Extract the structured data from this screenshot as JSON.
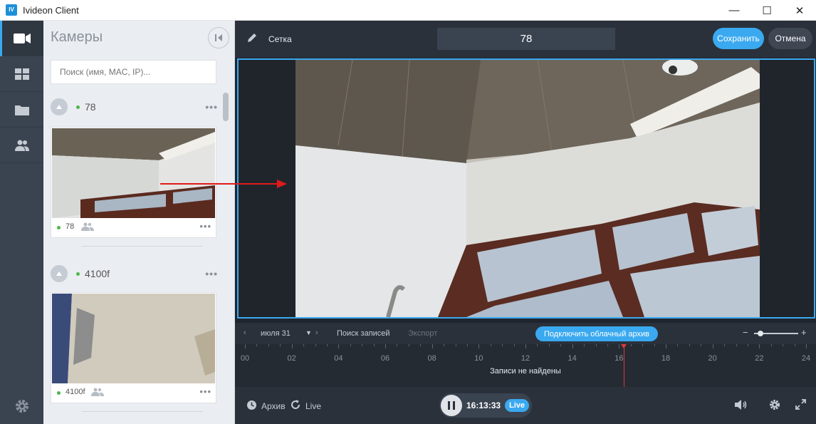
{
  "window": {
    "title": "Ivideon Client",
    "logo_text": "IV",
    "minimize": "—",
    "maximize": "☐",
    "close": "✕"
  },
  "nav": {
    "items": [
      {
        "icon": "camera-icon",
        "active": true
      },
      {
        "icon": "grid-icon",
        "active": false
      },
      {
        "icon": "folder-icon",
        "active": false
      },
      {
        "icon": "users-icon",
        "active": false
      }
    ],
    "settings_icon": "gear-icon"
  },
  "cameras_panel": {
    "title": "Камеры",
    "search_placeholder": "Поиск (имя, MAC, IP)...",
    "groups": [
      {
        "name": "78",
        "status_color": "#4cb84c",
        "camera": {
          "name": "78"
        }
      },
      {
        "name": "4100f",
        "status_color": "#4cb84c",
        "camera": {
          "name": "4100f"
        }
      }
    ]
  },
  "layout_editor": {
    "mode_label": "Сетка",
    "layout_name": "78",
    "save_label": "Сохранить",
    "cancel_label": "Отмена"
  },
  "timeline": {
    "date_label": "июля 31",
    "search_records_label": "Поиск записей",
    "export_label": "Экспорт",
    "cloud_archive_label": "Подключить облачный архив",
    "zoom_minus": "−",
    "zoom_plus": "+",
    "zoom_level": 0.15,
    "hours": [
      "00",
      "02",
      "04",
      "06",
      "08",
      "10",
      "12",
      "14",
      "16",
      "18",
      "20",
      "22",
      "24"
    ],
    "no_records_label": "Записи не найдены",
    "playhead_time": "16:13"
  },
  "player": {
    "archive_label": "Архив",
    "live_label": "Live",
    "current_time": "16:13:33",
    "live_badge": "Live"
  },
  "colors": {
    "accent": "#3aa9f0",
    "status_online": "#4cb84c",
    "playhead": "#e03a3a",
    "arrow": "#e01a1a"
  }
}
